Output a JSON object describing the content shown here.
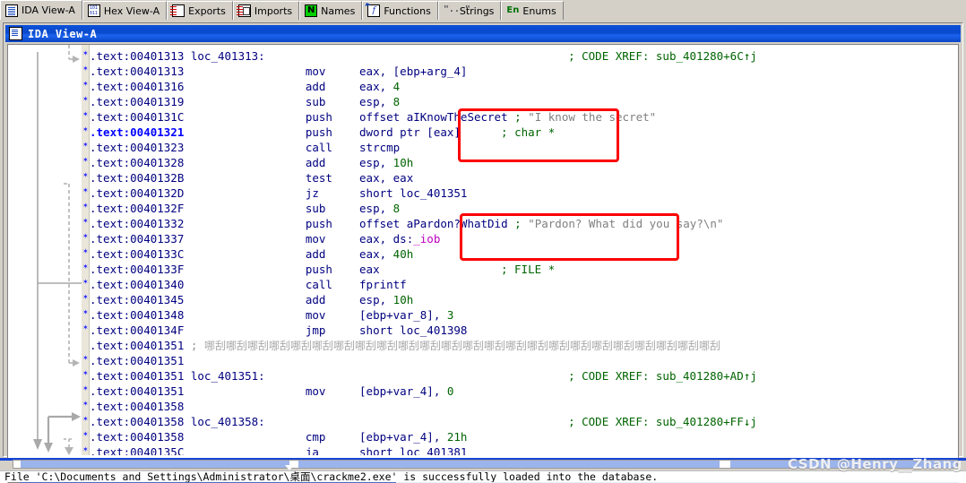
{
  "tabs": [
    {
      "label": "IDA View-A",
      "icon": "document-icon",
      "active": true
    },
    {
      "label": "Hex View-A",
      "icon": "hex-binary-icon",
      "active": false
    },
    {
      "label": "Exports",
      "icon": "exports-icon",
      "active": false
    },
    {
      "label": "Imports",
      "icon": "imports-icon",
      "active": false
    },
    {
      "label": "Names",
      "icon": "names-n-icon",
      "active": false
    },
    {
      "label": "Functions",
      "icon": "functions-f-icon",
      "active": false
    },
    {
      "label": "Strings",
      "icon": "strings-quote-icon",
      "active": false
    },
    {
      "label": "Enums",
      "icon": "enums-en-icon",
      "active": false
    }
  ],
  "window": {
    "title": "IDA View-A",
    "icon": "document-icon"
  },
  "disassembly": {
    "lines": [
      {
        "addr": ".text:00401313",
        "highlight": false,
        "label": "loc_401313:",
        "mnemonic": "",
        "operands": "",
        "comment": "; CODE XREF: sub_401280+6C↑j"
      },
      {
        "addr": ".text:00401313",
        "highlight": false,
        "label": "",
        "mnemonic": "mov",
        "operands": "eax, [ebp+arg_4]",
        "comment": ""
      },
      {
        "addr": ".text:00401316",
        "highlight": false,
        "label": "",
        "mnemonic": "add",
        "operands": "eax, 4",
        "comment": ""
      },
      {
        "addr": ".text:00401319",
        "highlight": false,
        "label": "",
        "mnemonic": "sub",
        "operands": "esp, 8",
        "comment": ""
      },
      {
        "addr": ".text:0040131C",
        "highlight": false,
        "label": "",
        "mnemonic": "push",
        "operands": "offset aIKnowTheSecret",
        "comment": "; \"I know the secret\"",
        "string_comment": true
      },
      {
        "addr": ".text:00401321",
        "highlight": true,
        "label": "",
        "mnemonic": "push",
        "operands": "dword ptr [eax]",
        "comment": "; char *"
      },
      {
        "addr": ".text:00401323",
        "highlight": false,
        "label": "",
        "mnemonic": "call",
        "operands": "strcmp",
        "comment": ""
      },
      {
        "addr": ".text:00401328",
        "highlight": false,
        "label": "",
        "mnemonic": "add",
        "operands": "esp, 10h",
        "comment": ""
      },
      {
        "addr": ".text:0040132B",
        "highlight": false,
        "label": "",
        "mnemonic": "test",
        "operands": "eax, eax",
        "comment": ""
      },
      {
        "addr": ".text:0040132D",
        "highlight": false,
        "label": "",
        "mnemonic": "jz",
        "operands": "short loc_401351",
        "comment": ""
      },
      {
        "addr": ".text:0040132F",
        "highlight": false,
        "label": "",
        "mnemonic": "sub",
        "operands": "esp, 8",
        "comment": ""
      },
      {
        "addr": ".text:00401332",
        "highlight": false,
        "label": "",
        "mnemonic": "push",
        "operands": "offset aPardon?WhatDid",
        "comment": "; \"Pardon? What did you say?\\n\"",
        "string_comment": true
      },
      {
        "addr": ".text:00401337",
        "highlight": false,
        "label": "",
        "mnemonic": "mov",
        "operands": "eax, ds:_iob",
        "comment": ""
      },
      {
        "addr": ".text:0040133C",
        "highlight": false,
        "label": "",
        "mnemonic": "add",
        "operands": "eax, 40h",
        "comment": ""
      },
      {
        "addr": ".text:0040133F",
        "highlight": false,
        "label": "",
        "mnemonic": "push",
        "operands": "eax",
        "comment": "; FILE *"
      },
      {
        "addr": ".text:00401340",
        "highlight": false,
        "label": "",
        "mnemonic": "call",
        "operands": "fprintf",
        "comment": ""
      },
      {
        "addr": ".text:00401345",
        "highlight": false,
        "label": "",
        "mnemonic": "add",
        "operands": "esp, 10h",
        "comment": ""
      },
      {
        "addr": ".text:00401348",
        "highlight": false,
        "label": "",
        "mnemonic": "mov",
        "operands": "[ebp+var_8], 3",
        "comment": ""
      },
      {
        "addr": ".text:0040134F",
        "highlight": false,
        "label": "",
        "mnemonic": "jmp",
        "operands": "short loc_401398",
        "comment": ""
      },
      {
        "addr": ".text:00401351",
        "highlight": false,
        "separator": true,
        "comment": ""
      },
      {
        "addr": ".text:00401351",
        "highlight": false,
        "label": "",
        "mnemonic": "",
        "operands": "",
        "comment": ""
      },
      {
        "addr": ".text:00401351",
        "highlight": false,
        "label": "loc_401351:",
        "mnemonic": "",
        "operands": "",
        "comment": "; CODE XREF: sub_401280+AD↑j"
      },
      {
        "addr": ".text:00401351",
        "highlight": false,
        "label": "",
        "mnemonic": "mov",
        "operands": "[ebp+var_4], 0",
        "comment": ""
      },
      {
        "addr": ".text:00401358",
        "highlight": false,
        "label": "",
        "mnemonic": "",
        "operands": "",
        "comment": ""
      },
      {
        "addr": ".text:00401358",
        "highlight": false,
        "label": "loc_401358:",
        "mnemonic": "",
        "operands": "",
        "comment": "; CODE XREF: sub_401280+FF↓j"
      },
      {
        "addr": ".text:00401358",
        "highlight": false,
        "label": "",
        "mnemonic": "cmp",
        "operands": "[ebp+var_4], 21h",
        "comment": ""
      },
      {
        "addr": ".text:0040135C",
        "highlight": false,
        "label": "",
        "mnemonic": "ja",
        "operands": "short loc_401381",
        "comment": ""
      }
    ],
    "separator_glyph": "哪刮哪刮哪刮哪刮哪刮哪刮哪刮哪刮哪刮哪刮哪刮哪刮哪刮哪刮哪刮哪刮哪刮哪刮哪刮哪刮哪刮哪刮哪刮哪刮"
  },
  "annotations": [
    {
      "name": "i-know-the-secret-highlight",
      "color": "#fb0000"
    },
    {
      "name": "pardon-what-did-you-say-highlight",
      "color": "#fb0000"
    }
  ],
  "scrollbar": {
    "left_arrow": "‹",
    "thumb_grip": "‖‖"
  },
  "statusbar": {
    "text": "File 'C:\\Documents and Settings\\Administrator\\桌面\\crackme2.exe' is successfully loaded into the database."
  },
  "watermark": {
    "text": "CSDN @Henry__Zhang"
  },
  "colors": {
    "accent": "#0a49cc",
    "annotation": "#fb0000",
    "comment": "#006400",
    "address": "#000080",
    "highlight_address": "#0000ff",
    "string_value": "#808080",
    "import_symbol": "#c000c0"
  }
}
